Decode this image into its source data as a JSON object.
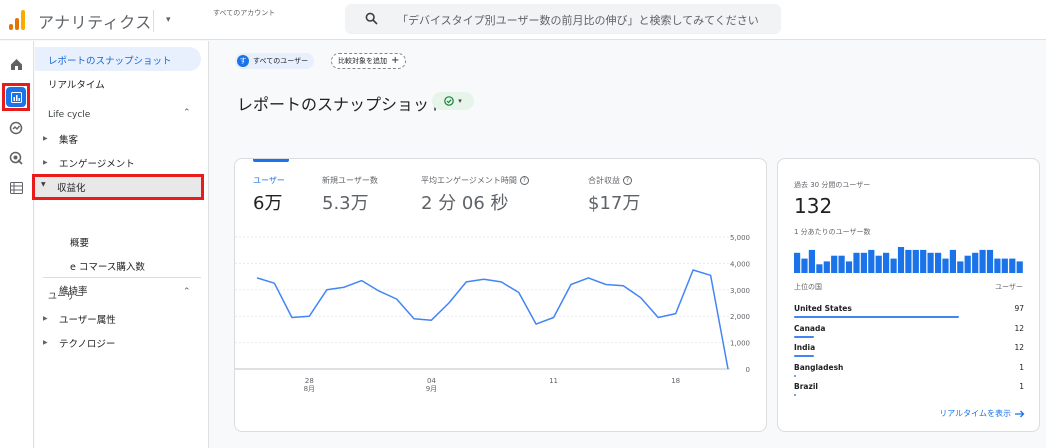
{
  "header": {
    "app_title": "アナリティクス",
    "account_label": "すべてのアカウント",
    "search_placeholder": "「デバイスタイプ別ユーザー数の前月比の伸び」と検索してみてください"
  },
  "sidebar": {
    "items": [
      {
        "label": "レポートのスナップショット"
      },
      {
        "label": "リアルタイム"
      }
    ],
    "lifecycle": {
      "header": "Life cycle",
      "items": [
        {
          "label": "集客"
        },
        {
          "label": "エンゲージメント"
        },
        {
          "label": "収益化"
        },
        {
          "label": "概要"
        },
        {
          "label": "e コマース購入数"
        },
        {
          "label": "維持率"
        }
      ]
    },
    "user": {
      "header": "ユーザー",
      "items": [
        {
          "label": "ユーザー属性"
        },
        {
          "label": "テクノロジー"
        }
      ]
    }
  },
  "filters": {
    "user_chip_avatar": "す",
    "user_chip": "すべてのユーザー",
    "compare_chip": "比較対象を追加"
  },
  "page": {
    "title": "レポートのスナップショット"
  },
  "metrics": [
    {
      "label": "ユーザー",
      "value": "6万"
    },
    {
      "label": "新規ユーザー数",
      "value": "5.3万"
    },
    {
      "label": "平均エンゲージメント時間",
      "value": "2 分 06 秒"
    },
    {
      "label": "合計収益",
      "value": "$17万"
    }
  ],
  "chart_data": {
    "type": "line",
    "title": "",
    "xlabel": "",
    "ylabel": "",
    "x_tick_labels": [
      {
        "day": "28",
        "month": "8月"
      },
      {
        "day": "04",
        "month": "9月"
      },
      {
        "day": "11",
        "month": ""
      },
      {
        "day": "18",
        "month": ""
      }
    ],
    "x_tick_indices": [
      3,
      10,
      17,
      24
    ],
    "y_ticks": [
      0,
      1000,
      2000,
      3000,
      4000,
      5000
    ],
    "y_tick_labels": [
      "0",
      "1,000",
      "2,000",
      "3,000",
      "4,000",
      "5,000"
    ],
    "ylim": [
      0,
      5000
    ],
    "grid": true,
    "series": [
      {
        "color": "#4285f4",
        "values": [
          3450,
          3250,
          1950,
          2000,
          3000,
          3100,
          3350,
          2950,
          2650,
          1900,
          1850,
          2500,
          3300,
          3400,
          3300,
          2900,
          1700,
          1950,
          3200,
          3450,
          3200,
          3150,
          2700,
          1950,
          2100,
          3750,
          3550,
          0
        ]
      }
    ]
  },
  "realtime": {
    "title": "過去 30 分間のユーザー",
    "value": "132",
    "subtitle": "1 分あたりのユーザー数",
    "per_minute": [
      7,
      5,
      8,
      3,
      4,
      6,
      6,
      4,
      7,
      7,
      8,
      6,
      7,
      5,
      9,
      8,
      8,
      8,
      7,
      7,
      5,
      8,
      4,
      6,
      7,
      8,
      8,
      5,
      5,
      5,
      4
    ],
    "countries_header": "上位の国",
    "users_header": "ユーザー",
    "countries": [
      {
        "name": "United States",
        "users": "97",
        "share": 0.97
      },
      {
        "name": "Canada",
        "users": "12",
        "share": 0.12
      },
      {
        "name": "India",
        "users": "12",
        "share": 0.12
      },
      {
        "name": "Bangladesh",
        "users": "1",
        "share": 0.01
      },
      {
        "name": "Brazil",
        "users": "1",
        "share": 0.01
      }
    ],
    "link": "リアルタイムを表示"
  }
}
